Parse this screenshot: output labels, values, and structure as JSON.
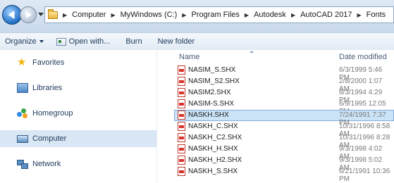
{
  "address_bar": {
    "crumbs": [
      "Computer",
      "MyWindows (C:)",
      "Program Files",
      "Autodesk",
      "AutoCAD 2017",
      "Fonts"
    ]
  },
  "toolbar": {
    "organize": "Organize",
    "open_with": "Open with...",
    "burn": "Burn",
    "new_folder": "New folder"
  },
  "nav": {
    "favorites": "Favorites",
    "libraries": "Libraries",
    "homegroup": "Homegroup",
    "computer": "Computer",
    "network": "Network"
  },
  "columns": {
    "name": "Name",
    "date": "Date modified"
  },
  "files": [
    {
      "name": "NASIM_S.SHX",
      "date": "6/3/1999 5:46 PM"
    },
    {
      "name": "NASIM_S2.SHX",
      "date": "2/8/2000 1:07 AM"
    },
    {
      "name": "NASIM2.SHX",
      "date": "8/3/1994 4:29 PM"
    },
    {
      "name": "NASIM-S.SHX",
      "date": "6/9/1995 12:05 PM"
    },
    {
      "name": "NASKH.SHX",
      "date": "7/24/1991 7:37 PM"
    },
    {
      "name": "NASKH_C.SHX",
      "date": "10/31/1996 8:58 AM"
    },
    {
      "name": "NASKH_C2.SHX",
      "date": "10/31/1996 8:28 AM"
    },
    {
      "name": "NASKH_H.SHX",
      "date": "9/3/1998 4:02 AM"
    },
    {
      "name": "NASKH_H2.SHX",
      "date": "9/3/1998 5:02 AM"
    },
    {
      "name": "NASKH_S.SHX",
      "date": "6/21/1991 10:36 PM"
    }
  ],
  "selected_file": "NASKH.SHX",
  "colors": {
    "accent": "#1e395b",
    "selection": "#cce4f7",
    "file_icon": "#d8322b",
    "star": "#f2b30c"
  }
}
